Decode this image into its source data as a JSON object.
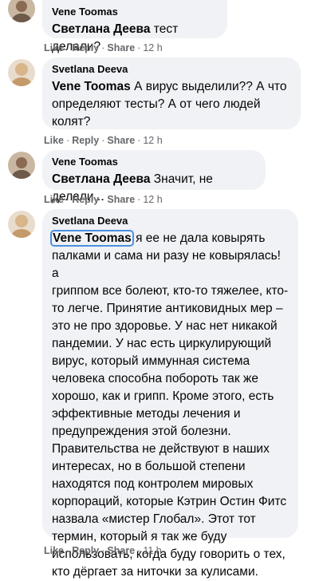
{
  "comments": [
    {
      "author": "Vene Toomas",
      "mention": "Светлана Деева",
      "text": " тест делали?",
      "actions": {
        "like": "Like",
        "reply": "Reply",
        "share": "Share",
        "time": "12 h"
      }
    },
    {
      "author": "Svetlana Deeva",
      "mention": "Vene Toomas",
      "text": " А вирус выделили?? А что\nопределяют тесты? А от чего людей\nколят?",
      "actions": {
        "like": "Like",
        "reply": "Reply",
        "share": "Share",
        "time": "12 h"
      }
    },
    {
      "author": "Vene Toomas",
      "mention": "Светлана Деева",
      "text": " Значит, не делали...",
      "actions": {
        "like": "Like",
        "reply": "Reply",
        "share": "Share",
        "time": "12 h"
      }
    },
    {
      "author": "Svetlana Deeva",
      "mention": "Vene Toomas",
      "text": " я ее не дала ковырять\nпалками и сама ни разу не ковырялась! а\nгриппом все болеют, кто-то тяжелее, кто-\nто легче. Принятие антиковидных мер –\nэто не про здоровье. У нас нет никакой\nпандемии. У нас есть циркулирующий\nвирус, который иммунная система\nчеловека способна побороть так же\nхорошо, как и грипп. Кроме этого, есть\nэффективные методы лечения и\nпредупреждения этой болезни.\nПравительства не действуют в наших\nинтересах, но в большой степени\nнаходятся под контролем мировых\nкорпораций, которые Кэтрин Остин Фитс\nназвала «мистер Глобал». Этот тот\nтермин, который я так же буду\nиспользовать, когда буду говорить о тех,\nкто дёргает за ниточки за кулисами.",
      "actions": {
        "like": "Like",
        "reply": "Reply",
        "share": "Share",
        "time": "11 h"
      }
    }
  ]
}
